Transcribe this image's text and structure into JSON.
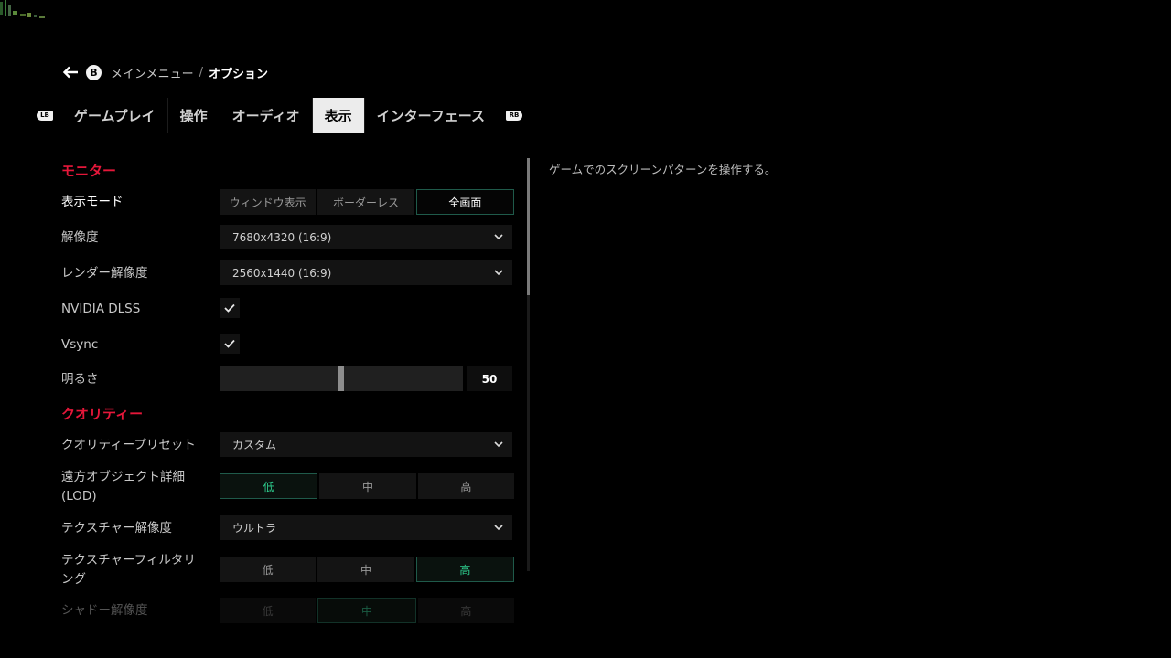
{
  "breadcrumb": {
    "button": "B",
    "parent": "メインメニュー",
    "separator": "/",
    "current": "オプション"
  },
  "tabs": {
    "lb": "LB",
    "rb": "RB",
    "items": [
      "ゲームプレイ",
      "操作",
      "オーディオ",
      "表示",
      "インターフェース"
    ],
    "active_index": 3
  },
  "sections": {
    "monitor": "モニター",
    "quality": "クオリティー"
  },
  "monitor": {
    "display_mode": {
      "label": "表示モード",
      "options": [
        "ウィンドウ表示",
        "ボーダーレス",
        "全画面"
      ],
      "selected": "全画面"
    },
    "resolution": {
      "label": "解像度",
      "value": "7680x4320 (16:9)"
    },
    "render_resolution": {
      "label": "レンダー解像度",
      "value": "2560x1440 (16:9)"
    },
    "dlss": {
      "label": "NVIDIA DLSS",
      "checked": true
    },
    "vsync": {
      "label": "Vsync",
      "checked": true
    },
    "brightness": {
      "label": "明るさ",
      "value": "50",
      "fraction": 0.5
    }
  },
  "quality": {
    "preset": {
      "label": "クオリティープリセット",
      "value": "カスタム"
    },
    "lod": {
      "label_line1": "遠方オブジェクト詳細",
      "label_line2": "(LOD)",
      "options": [
        "低",
        "中",
        "高"
      ],
      "selected": "低"
    },
    "texture_res": {
      "label": "テクスチャー解像度",
      "value": "ウルトラ"
    },
    "texture_filter": {
      "label_line1": "テクスチャーフィルタリ",
      "label_line2": "ング",
      "options": [
        "低",
        "中",
        "高"
      ],
      "selected": "高"
    },
    "shadow_res": {
      "label": "シャドー解像度",
      "options": [
        "低",
        "中",
        "高"
      ],
      "selected": "中"
    }
  },
  "description": "ゲームでのスクリーンパターンを操作する。",
  "colors": {
    "accent_red": "#e5173a",
    "accent_green": "#2ecf8f",
    "background": "#000000"
  }
}
